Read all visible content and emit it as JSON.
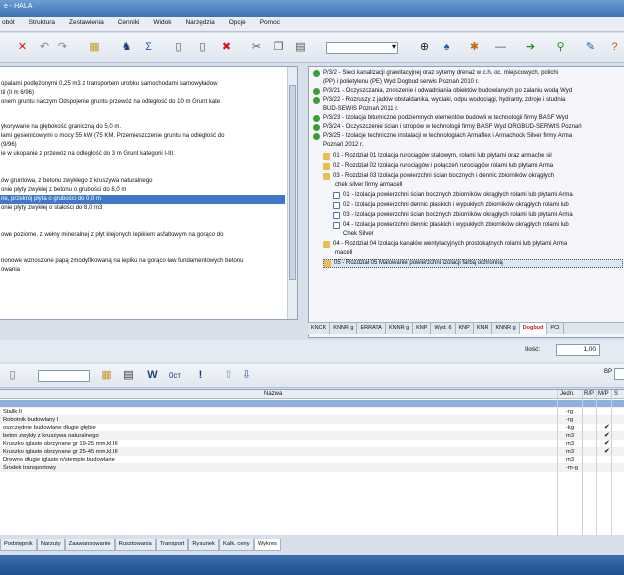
{
  "window": {
    "title": "e - HALA"
  },
  "menu": [
    "obót",
    "Struktura",
    "Zestawienia",
    "Cenniki",
    "Widok",
    "Narzędzia",
    "Opcje",
    "Pomoc"
  ],
  "toolbar": {
    "icons": [
      "undo-icon",
      "redo-icon",
      "tree-icon",
      "paste-icon",
      "sum-icon",
      "new-page-icon",
      "copy-page-icon",
      "delete-icon",
      "cut-icon",
      "copy-icon",
      "paste-icon",
      "binoculars-icon",
      "search-icon",
      "tools-icon",
      "minus-icon",
      "add-icon",
      "branch-icon",
      "edit-icon",
      "help-icon"
    ],
    "combo_value": ""
  },
  "left_panel": {
    "lines": [
      "",
      "opalami podlężonymi 0,25 m3 z transportem urobku samochodami samowyładow",
      "til (Il m 6/96)",
      "onem gruntu naczym Odspojenie gruntu przewóz na odległość do 10 m Grunt kate",
      "",
      "ykorywane na głębokość graniczną do 5,0 m.",
      "łami gęsienicowymi o mocy 55 kW (75 KM. Przemieszczenie gruntu na odległość do",
      "(9/96)",
      "ie w ukopanie z przewóz na odległość do 3 m Grunt kategorii I-III.",
      "",
      "ów gruntowa, z betonu zwykłego z kruszywa naturalnego",
      "onie płyty zwykłej z betonu o grubości do 8,0 m",
      "ne, przekrój płyta o grubości do 0,0 m",
      "onie płyty zwykłej o stałości do 8,0 m3",
      "",
      "owe poziome, z wełny mineralnej z płyt klejonych lepikiem asfaltowym na gorąco do",
      "",
      "nonowe wznoszone papą zmodyfikowaną na lepiku na gorąco ław fundamentowych betonu",
      "owania"
    ],
    "selected_index": 12
  },
  "right_panel": {
    "items": [
      {
        "icon": "green",
        "text": "P/3/2 - Sieci kanalizacji grawitacyjnej oraz sytemy drenaż w c.h. oc. miejscowych, polichi"
      },
      {
        "icon": "none",
        "text": "(PP) i polietylenu (PE) Wyd Dogbud serwis Poznań 2010 r."
      },
      {
        "icon": "green",
        "text": "P/3/21 - Oczyszczania, znoszenie i odwadniania obiektów budowlanych po zalaniu wodą Wyd"
      },
      {
        "icon": "green",
        "text": "P/3/22 - Rozruszy z jadów obstaldanika, wyciaki, odpu wodociągi, hydranty, zdroje i studnia"
      },
      {
        "icon": "none",
        "text": "BUD-SEWIS Poznań 2011 r."
      },
      {
        "icon": "green",
        "text": "P/3/23 - Izolacja bitumiczne podziemnych elementów budowli w technologii firmy BASF Wyd"
      },
      {
        "icon": "green",
        "text": "P/3/24 - Oczyszczenie ścian i stropów w technologii firmy BASF Wyd ORGBUD-SERWIS Poznań"
      },
      {
        "icon": "green",
        "text": "P/3/25 - Izolacje techniczne instalacji w technologiach Armaflex i Armachock Silver firmy Arma"
      },
      {
        "icon": "none",
        "text": "Poznań 2012 r."
      },
      {
        "icon": "folder",
        "text": "01 - Rozdział 01 Izolacja rurociągów stalowym, rolami lub płytami oraz armache sil"
      },
      {
        "icon": "folder",
        "text": "02 - Rozdział 02 Izolacja rurociągów i połączeń rurociągów rolami lub płytami Arma"
      },
      {
        "icon": "folder",
        "text": "03 - Rozdział 03 Izolacja powierzchni ścian bocznych i dennic zbiorników okrągłych"
      },
      {
        "icon": "none",
        "text": "chek silver firmy armacell"
      },
      {
        "icon": "doc",
        "text": "01 - Izolacja powierzchni ścian bocznych zbiorników okrągłych rolami lub płytami Arma"
      },
      {
        "icon": "doc",
        "text": "02 - Izolacja powierzchni dennic płaskich i wypukłych zbiorników okrągłych rolami lub"
      },
      {
        "icon": "doc",
        "text": "03 - Izolacja powierzchni ścian bocznych zbiorników okrągłych rolami lub płytami Arma"
      },
      {
        "icon": "doc",
        "text": "04 - Izolacja powierzchni dennic płaskich i wypukłych zbiorników okrągłych rolami lub"
      },
      {
        "icon": "none",
        "text": "Chek Silver"
      },
      {
        "icon": "folder",
        "text": "04 - Rozdział 04 Izolacja kanałów wentylacyjnych prostokątnych rolami lub płytami Arma"
      },
      {
        "icon": "none",
        "text": "macell"
      },
      {
        "icon": "folder",
        "text": "05 - Rozdział 05 Malowanie powierzchni izolacji farbą ochronną"
      }
    ],
    "selected_index": 20,
    "tabs": [
      "KNCK",
      "KNNR g",
      "ERRATA",
      "KNNR g",
      "KNP",
      "Wyd. 6",
      "KNP",
      "KNR",
      "KNNR g",
      "Dogbud",
      "PCI"
    ],
    "active_tab": 9
  },
  "quantity": {
    "label": "Ilość:",
    "value": "1,00"
  },
  "toolbar2": {
    "icons": [
      "paste-icon",
      "calculator-icon",
      "w-icon",
      "zoom-icon",
      "exclamation-icon",
      "up-arrow-icon",
      "down-arrow-icon"
    ],
    "w_label": "W",
    "zoom_label": "0ст",
    "excl_label": "!",
    "bp_label": "BP"
  },
  "grid": {
    "headers": {
      "name": "Nazwa",
      "unit": "Jedn.",
      "c1": "R/P",
      "c2": "M/P",
      "c3": "S"
    },
    "rows": [
      {
        "name": "",
        "unit": "",
        "check": ""
      },
      {
        "name": "Stalik II",
        "unit": "-rg",
        "check": ""
      },
      {
        "name": "Robotnik budowlany I",
        "unit": "-rg",
        "check": ""
      },
      {
        "name": "oszczędnie budowlane długie głębie",
        "unit": "-kg",
        "check": "✔"
      },
      {
        "name": "beton zwykły z kruszywa naturalnego",
        "unit": "m3",
        "check": "✔"
      },
      {
        "name": "Kruszko iglaste obrzynane gr 19-25 mm,kl.III",
        "unit": "m3",
        "check": "✔"
      },
      {
        "name": "Kruszko iglaste obrzynane gr 25-45 mm,kl.III",
        "unit": "m3",
        "check": "✔"
      },
      {
        "name": "Drewno długie iglaste n/stemple budowlane",
        "unit": "m3",
        "check": ""
      },
      {
        "name": "Środek transportowy",
        "unit": "-m-g",
        "check": ""
      }
    ]
  },
  "bottom_tabs": [
    "Podstępnik",
    "Narzuty",
    "Zaawansowanie",
    "Rusztowania",
    "Transport",
    "Rysunek",
    "Kalk. ceny",
    "Wykres"
  ],
  "bottom_active": 7
}
